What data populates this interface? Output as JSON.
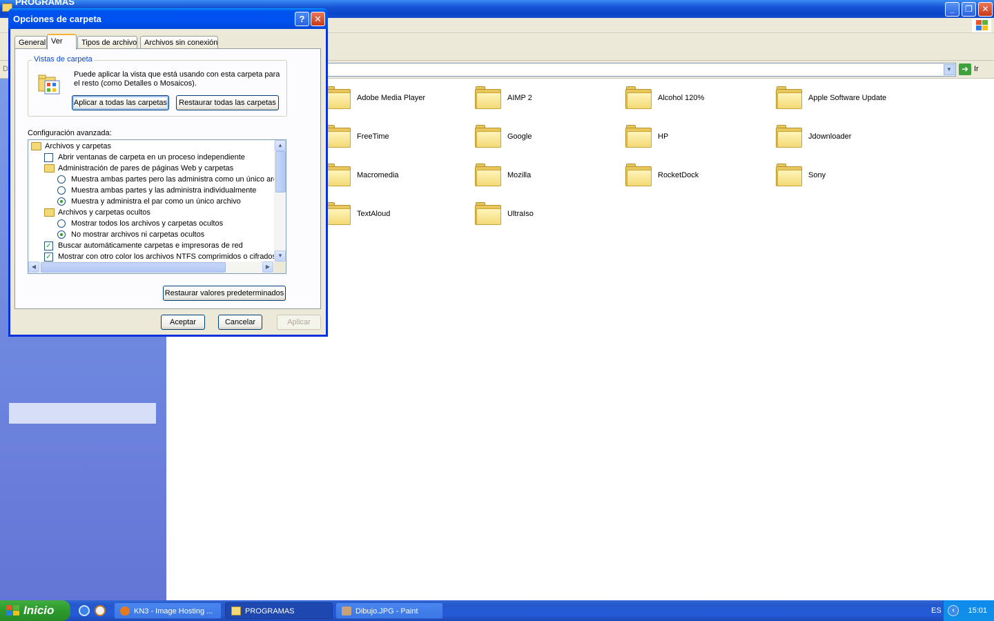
{
  "explorer": {
    "title": "PROGRAMAS",
    "address_prefix": "D",
    "go_label": "Ir",
    "folders": [
      {
        "name": "Adobe Media Player"
      },
      {
        "name": "AIMP 2"
      },
      {
        "name": "Alcohol 120%"
      },
      {
        "name": "Apple Software Update"
      },
      {
        "name": "FreeTime"
      },
      {
        "name": "Google"
      },
      {
        "name": "HP"
      },
      {
        "name": "Jdownloader"
      },
      {
        "name": "Macromedia"
      },
      {
        "name": "Mozilla"
      },
      {
        "name": "RocketDock"
      },
      {
        "name": "Sony"
      },
      {
        "name": "TextAloud"
      },
      {
        "name": "UltraIso"
      }
    ]
  },
  "dialog": {
    "title": "Opciones de carpeta",
    "help_glyph": "?",
    "close_glyph": "✕",
    "tabs": [
      {
        "label": "General"
      },
      {
        "label": "Ver"
      },
      {
        "label": "Tipos de archivo"
      },
      {
        "label": "Archivos sin conexión"
      }
    ],
    "selected_tab": "Ver",
    "folder_views": {
      "group_label": "Vistas de carpeta",
      "description": "Puede aplicar la vista que está usando con esta carpeta para el resto (como Detalles o Mosaicos).",
      "apply_all": "Aplicar a todas las carpetas",
      "reset_all": "Restaurar todas las carpetas"
    },
    "advanced": {
      "label": "Configuración avanzada:",
      "rows": [
        {
          "type": "folder",
          "level": 0,
          "text": "Archivos y carpetas"
        },
        {
          "type": "checkbox",
          "level": 1,
          "checked": false,
          "text": "Abrir ventanas de carpeta  en un proceso independiente"
        },
        {
          "type": "folder",
          "level": 1,
          "text": "Administración de pares de páginas Web y carpetas"
        },
        {
          "type": "radio",
          "level": 2,
          "checked": false,
          "text": "Muestra ambas partes pero las administra como un único arch"
        },
        {
          "type": "radio",
          "level": 2,
          "checked": false,
          "text": "Muestra ambas partes y las administra individualmente"
        },
        {
          "type": "radio",
          "level": 2,
          "checked": true,
          "text": "Muestra y administra el par como un único archivo"
        },
        {
          "type": "folder",
          "level": 1,
          "text": "Archivos y carpetas ocultos"
        },
        {
          "type": "radio",
          "level": 2,
          "checked": false,
          "text": "Mostrar todos los archivos y carpetas ocultos"
        },
        {
          "type": "radio",
          "level": 2,
          "checked": true,
          "text": "No mostrar archivos ni carpetas ocultos"
        },
        {
          "type": "checkbox",
          "level": 1,
          "checked": true,
          "text": "Buscar automáticamente carpetas e impresoras de red"
        },
        {
          "type": "checkbox",
          "level": 1,
          "checked": true,
          "text": "Mostrar con otro color los archivos NTFS comprimidos o cifrados"
        }
      ]
    },
    "restore_defaults": "Restaurar valores predeterminados",
    "ok": "Aceptar",
    "cancel": "Cancelar",
    "apply": "Aplicar"
  },
  "taskbar": {
    "start_label": "Inicio",
    "tasks": [
      {
        "label": "KN3 - Image Hosting ...",
        "active": false
      },
      {
        "label": "PROGRAMAS",
        "active": true
      },
      {
        "label": "Dibujo.JPG - Paint",
        "active": false
      }
    ],
    "language": "ES",
    "clock": "15:01"
  },
  "colors": {
    "xp_blue": "#0054e3",
    "start_green": "#3c9e3c",
    "folder_yellow": "#f3d976",
    "check_green": "#21a121"
  }
}
